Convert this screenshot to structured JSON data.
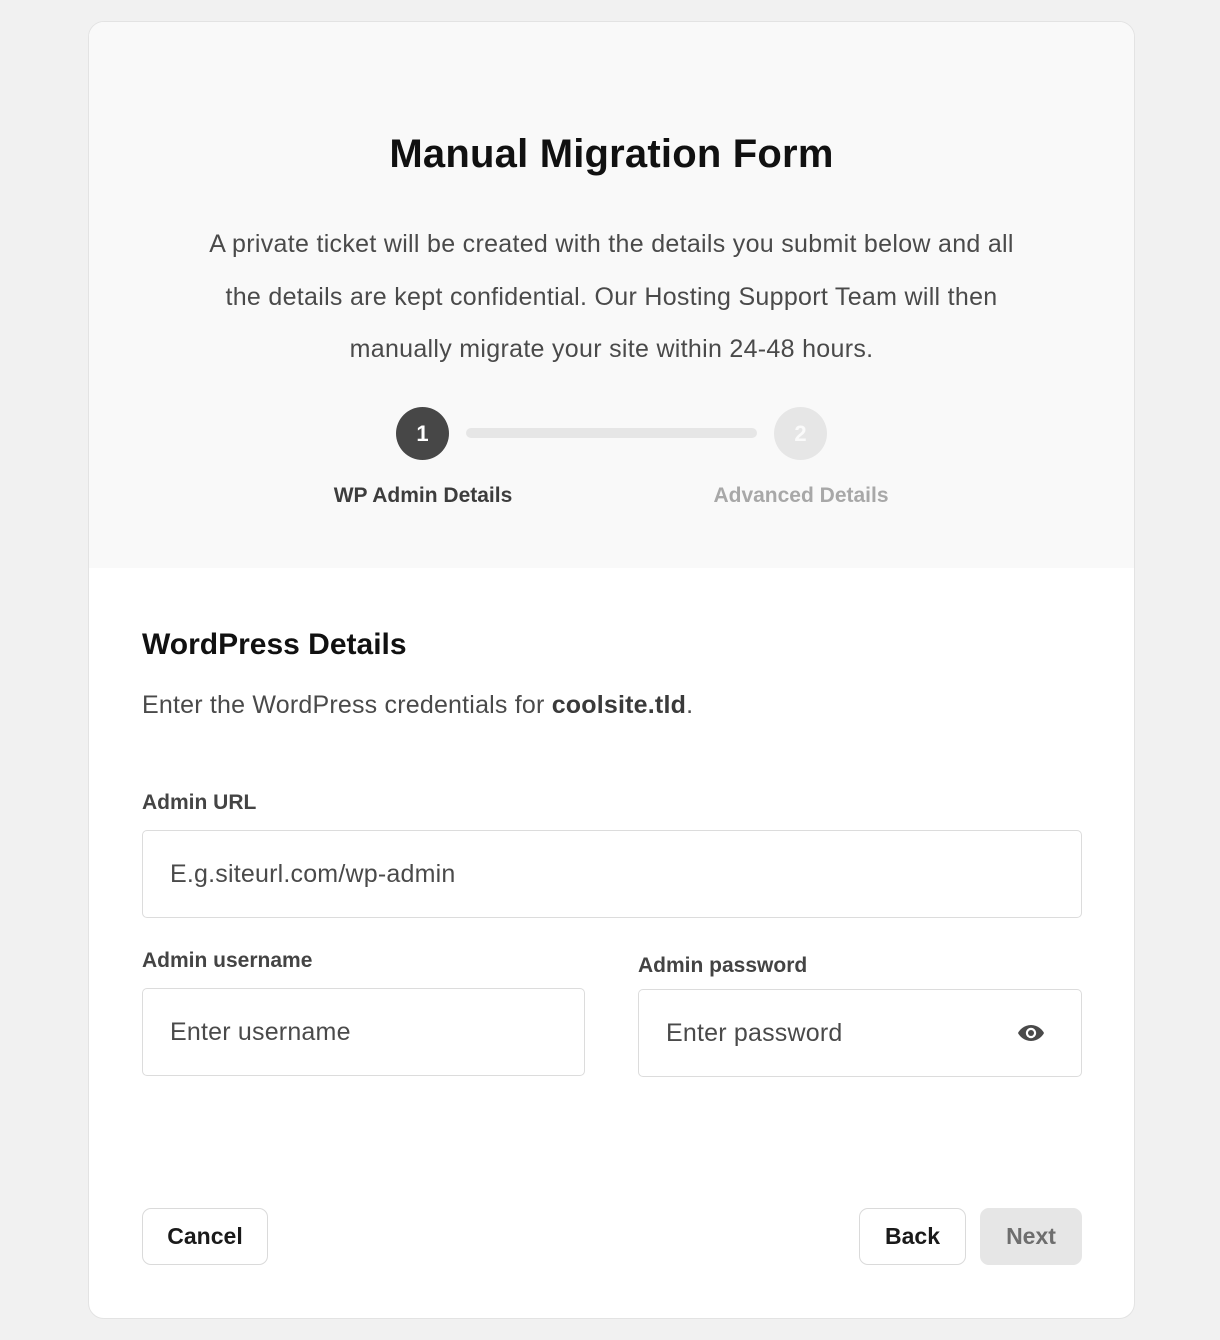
{
  "form": {
    "title": "Manual Migration Form",
    "description": "A private ticket will be created with the details you submit below and all the details are kept confidential. Our Hosting Support Team will then manually migrate your site within 24-48 hours."
  },
  "stepper": {
    "steps": [
      {
        "number": "1",
        "label": "WP Admin Details",
        "state": "active"
      },
      {
        "number": "2",
        "label": "Advanced Details",
        "state": "inactive"
      }
    ]
  },
  "section": {
    "title": "WordPress Details",
    "desc_prefix": "Enter the WordPress credentials for ",
    "site": "coolsite.tld",
    "desc_suffix": "."
  },
  "fields": {
    "admin_url": {
      "label": "Admin URL",
      "placeholder": "E.g.siteurl.com/wp-admin"
    },
    "username": {
      "label": "Admin username",
      "placeholder": "Enter username"
    },
    "password": {
      "label": "Admin password",
      "placeholder": "Enter password",
      "icon": "eye-icon"
    }
  },
  "buttons": {
    "cancel": "Cancel",
    "back": "Back",
    "next": "Next"
  },
  "colors": {
    "page_bg": "#f1f1f1",
    "header_bg": "#f9f9f9",
    "active_step": "#474747",
    "inactive_step": "#e6e6e6",
    "disabled_button": "#e6e6e6"
  }
}
